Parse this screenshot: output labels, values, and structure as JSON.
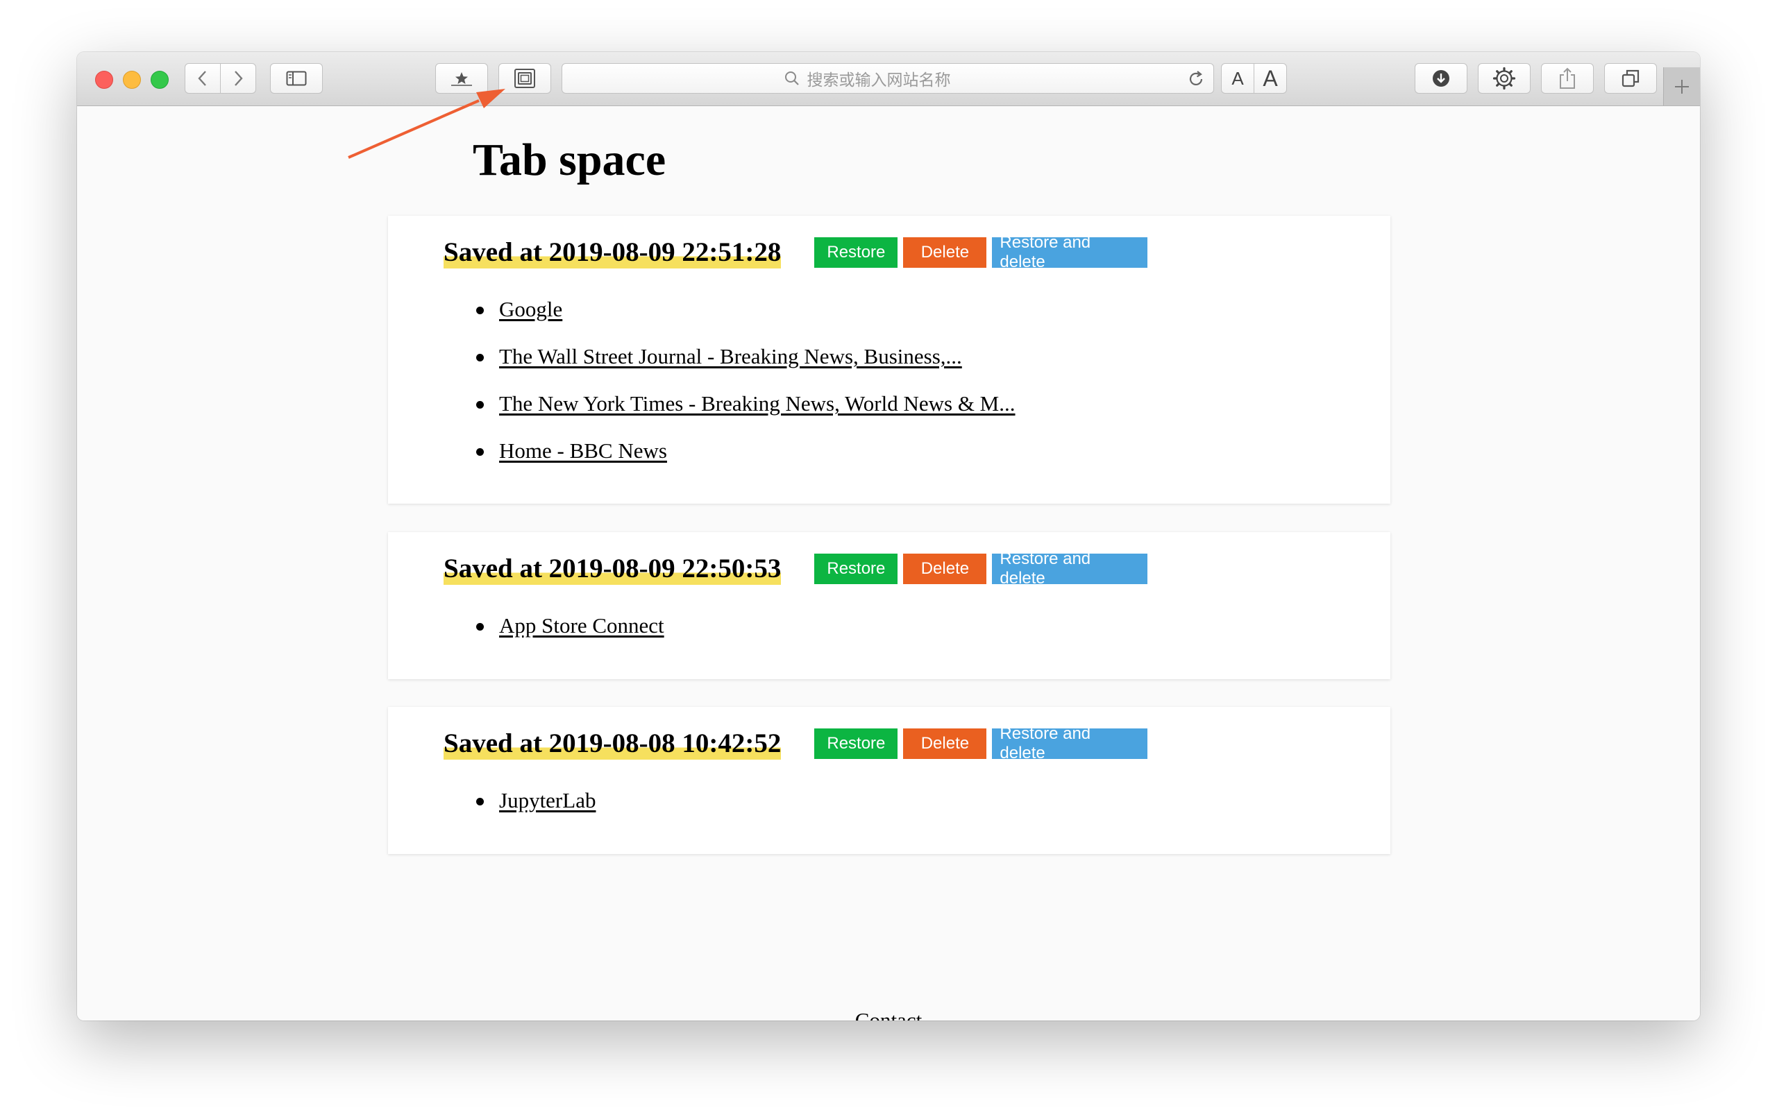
{
  "browser": {
    "address_placeholder": "搜索或输入网站名称",
    "font_small_label": "A",
    "font_large_label": "A",
    "new_tab_label": "+"
  },
  "page": {
    "title": "Tab space",
    "contact_label": "Contact"
  },
  "buttons": {
    "restore": "Restore",
    "delete": "Delete",
    "restore_delete": "Restore and delete"
  },
  "colors": {
    "restore": "#0cb542",
    "delete": "#ea6020",
    "restore_delete": "#4aa3df",
    "highlight": "#f6e05e",
    "annotation_arrow": "#ee5f33"
  },
  "sessions": [
    {
      "title": "Saved at 2019-08-09 22:51:28",
      "links": [
        "Google",
        "The Wall Street Journal - Breaking News, Business,...",
        "The New York Times - Breaking News, World News & M...",
        "Home - BBC News"
      ]
    },
    {
      "title": "Saved at 2019-08-09 22:50:53",
      "links": [
        "App Store Connect"
      ]
    },
    {
      "title": "Saved at 2019-08-08 10:42:52",
      "links": [
        "JupyterLab"
      ]
    }
  ]
}
